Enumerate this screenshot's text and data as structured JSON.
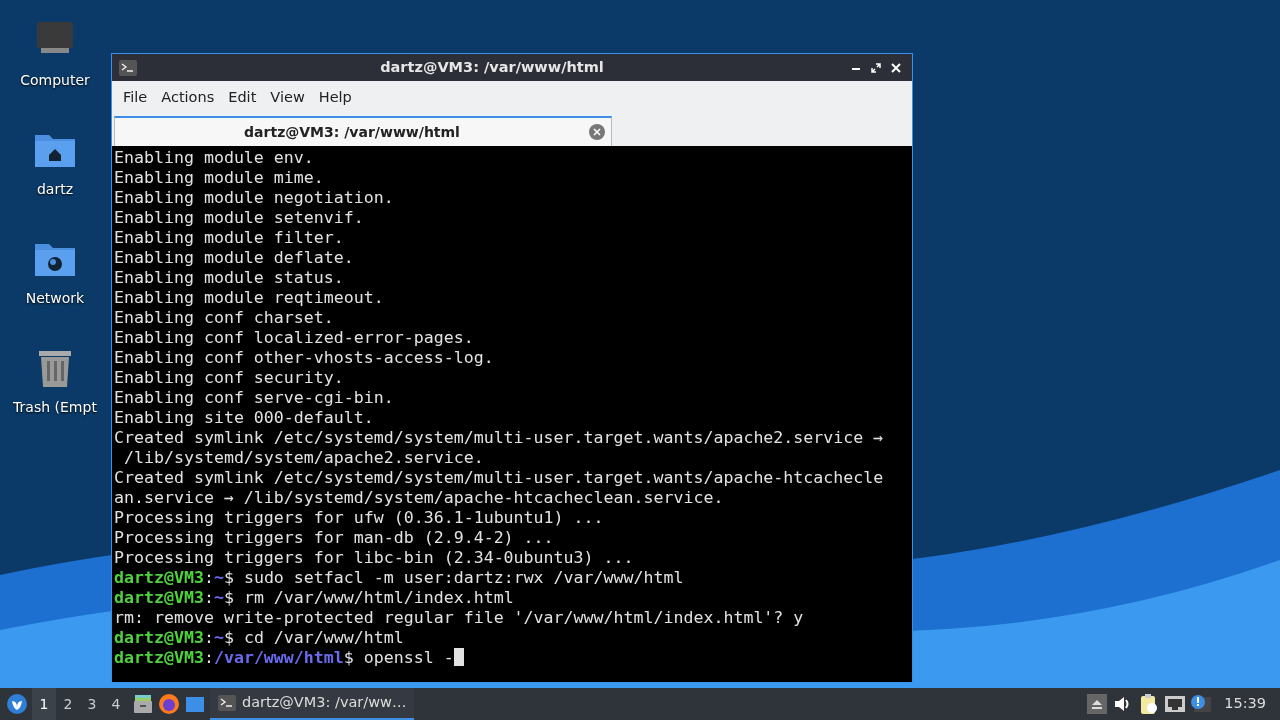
{
  "desktop_icons": [
    {
      "kind": "computer",
      "label": "Computer"
    },
    {
      "kind": "home",
      "label": "dartz"
    },
    {
      "kind": "network",
      "label": "Network"
    },
    {
      "kind": "trash",
      "label": "Trash (Empt"
    }
  ],
  "window": {
    "title": "dartz@VM3: /var/www/html",
    "menu": [
      "File",
      "Actions",
      "Edit",
      "View",
      "Help"
    ],
    "tabs": [
      {
        "label": "dartz@VM3: /var/www/html",
        "selected": true
      }
    ],
    "terminal": {
      "lines": [
        {
          "segments": [
            {
              "kind": "plain",
              "text": "Enabling module env."
            }
          ]
        },
        {
          "segments": [
            {
              "kind": "plain",
              "text": "Enabling module mime."
            }
          ]
        },
        {
          "segments": [
            {
              "kind": "plain",
              "text": "Enabling module negotiation."
            }
          ]
        },
        {
          "segments": [
            {
              "kind": "plain",
              "text": "Enabling module setenvif."
            }
          ]
        },
        {
          "segments": [
            {
              "kind": "plain",
              "text": "Enabling module filter."
            }
          ]
        },
        {
          "segments": [
            {
              "kind": "plain",
              "text": "Enabling module deflate."
            }
          ]
        },
        {
          "segments": [
            {
              "kind": "plain",
              "text": "Enabling module status."
            }
          ]
        },
        {
          "segments": [
            {
              "kind": "plain",
              "text": "Enabling module reqtimeout."
            }
          ]
        },
        {
          "segments": [
            {
              "kind": "plain",
              "text": "Enabling conf charset."
            }
          ]
        },
        {
          "segments": [
            {
              "kind": "plain",
              "text": "Enabling conf localized-error-pages."
            }
          ]
        },
        {
          "segments": [
            {
              "kind": "plain",
              "text": "Enabling conf other-vhosts-access-log."
            }
          ]
        },
        {
          "segments": [
            {
              "kind": "plain",
              "text": "Enabling conf security."
            }
          ]
        },
        {
          "segments": [
            {
              "kind": "plain",
              "text": "Enabling conf serve-cgi-bin."
            }
          ]
        },
        {
          "segments": [
            {
              "kind": "plain",
              "text": "Enabling site 000-default."
            }
          ]
        },
        {
          "segments": [
            {
              "kind": "plain",
              "text": "Created symlink /etc/systemd/system/multi-user.target.wants/apache2.service →"
            }
          ]
        },
        {
          "segments": [
            {
              "kind": "plain",
              "text": " /lib/systemd/system/apache2.service."
            }
          ]
        },
        {
          "segments": [
            {
              "kind": "plain",
              "text": "Created symlink /etc/systemd/system/multi-user.target.wants/apache-htcachecle"
            }
          ]
        },
        {
          "segments": [
            {
              "kind": "plain",
              "text": "an.service → /lib/systemd/system/apache-htcacheclean.service."
            }
          ]
        },
        {
          "segments": [
            {
              "kind": "plain",
              "text": "Processing triggers for ufw (0.36.1-1ubuntu1) ..."
            }
          ]
        },
        {
          "segments": [
            {
              "kind": "plain",
              "text": "Processing triggers for man-db (2.9.4-2) ..."
            }
          ]
        },
        {
          "segments": [
            {
              "kind": "plain",
              "text": "Processing triggers for libc-bin (2.34-0ubuntu3) ..."
            }
          ]
        },
        {
          "segments": [
            {
              "kind": "user",
              "text": "dartz@VM3"
            },
            {
              "kind": "plain",
              "text": ":"
            },
            {
              "kind": "path",
              "text": "~"
            },
            {
              "kind": "plain",
              "text": "$ sudo setfacl -m user:dartz:rwx /var/www/html"
            }
          ]
        },
        {
          "segments": [
            {
              "kind": "user",
              "text": "dartz@VM3"
            },
            {
              "kind": "plain",
              "text": ":"
            },
            {
              "kind": "path",
              "text": "~"
            },
            {
              "kind": "plain",
              "text": "$ rm /var/www/html/index.html"
            }
          ]
        },
        {
          "segments": [
            {
              "kind": "plain",
              "text": "rm: remove write-protected regular file '/var/www/html/index.html'? y"
            }
          ]
        },
        {
          "segments": [
            {
              "kind": "user",
              "text": "dartz@VM3"
            },
            {
              "kind": "plain",
              "text": ":"
            },
            {
              "kind": "path",
              "text": "~"
            },
            {
              "kind": "plain",
              "text": "$ cd /var/www/html"
            }
          ]
        },
        {
          "segments": [
            {
              "kind": "user",
              "text": "dartz@VM3"
            },
            {
              "kind": "plain",
              "text": ":"
            },
            {
              "kind": "path",
              "text": "/var/www/html"
            },
            {
              "kind": "plain",
              "text": "$ openssl -"
            }
          ],
          "cursor": true
        }
      ]
    }
  },
  "taskbar": {
    "workspaces": [
      {
        "label": "1",
        "selected": true
      },
      {
        "label": "2",
        "selected": false
      },
      {
        "label": "3",
        "selected": false
      },
      {
        "label": "4",
        "selected": false
      }
    ],
    "tasks": [
      {
        "label": "dartz@VM3: /var/ww…",
        "selected": true
      }
    ],
    "clock": "15:39"
  }
}
